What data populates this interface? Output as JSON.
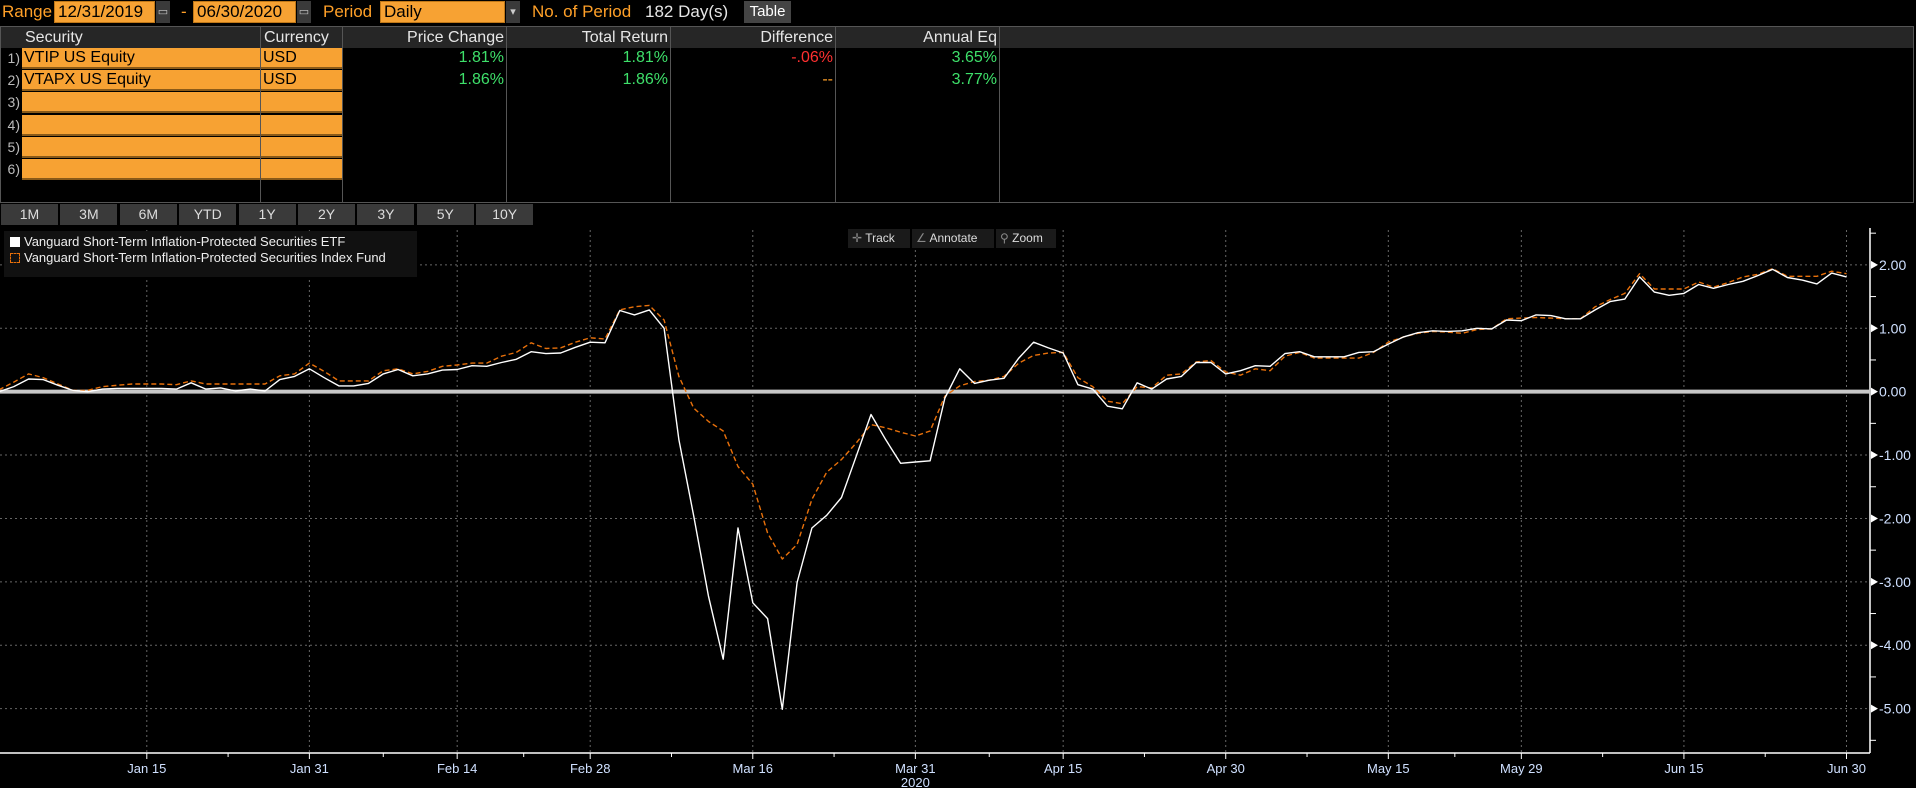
{
  "topbar": {
    "range_label": "Range",
    "start_date": "12/31/2019",
    "dash": "-",
    "end_date": "06/30/2020",
    "period_label": "Period",
    "period_value": "Daily",
    "num_period_label": "No. of Period",
    "num_period_value": "182 Day(s)",
    "table_button": "Table"
  },
  "table": {
    "headers": [
      "Security",
      "Currency",
      "Price Change",
      "Total Return",
      "Difference",
      "Annual Eq"
    ],
    "rows": [
      {
        "num": "1)",
        "security": "VTIP US Equity",
        "currency": "USD",
        "price_change": "1.81%",
        "total_return": "1.81%",
        "difference": "-.06%",
        "annual_eq": "3.65%"
      },
      {
        "num": "2)",
        "security": "VTAPX US Equity",
        "currency": "USD",
        "price_change": "1.86%",
        "total_return": "1.86%",
        "difference": "--",
        "annual_eq": "3.77%"
      },
      {
        "num": "3)",
        "security": "",
        "currency": ""
      },
      {
        "num": "4)",
        "security": "",
        "currency": ""
      },
      {
        "num": "5)",
        "security": "",
        "currency": ""
      },
      {
        "num": "6)",
        "security": "",
        "currency": ""
      }
    ]
  },
  "range_buttons": [
    "1M",
    "3M",
    "6M",
    "YTD",
    "1Y",
    "2Y",
    "3Y",
    "5Y",
    "10Y"
  ],
  "chart_tools": {
    "track": "Track",
    "annotate": "Annotate",
    "zoom": "Zoom"
  },
  "colors": {
    "accent_orange": "#f7a233",
    "positive": "#3ee06a",
    "negative": "#ff3030",
    "series_etf": "#ffffff",
    "series_fund": "#e8700a"
  },
  "chart_data": {
    "type": "line",
    "title": "",
    "xlabel": "2020",
    "ylabel": "",
    "ylim": [
      -5.7,
      2.55
    ],
    "yticks": [
      2,
      1,
      0,
      -1,
      -2,
      -3,
      -4,
      -5
    ],
    "grid": true,
    "legend_position": "top-left",
    "y_axis_side": "right",
    "xtick_dates": [
      "2020-01-15",
      "2020-01-31",
      "2020-02-14",
      "2020-02-28",
      "2020-03-16",
      "2020-03-31",
      "2020-04-15",
      "2020-04-30",
      "2020-05-15",
      "2020-05-29",
      "2020-06-15",
      "2020-06-30"
    ],
    "xtick_labels": [
      "Jan 15",
      "Jan 31",
      "Feb 14",
      "Feb 28",
      "Mar 16",
      "Mar 31",
      "Apr 15",
      "Apr 30",
      "May 15",
      "May 29",
      "Jun 15",
      "Jun 30"
    ],
    "x": [
      "2019-12-31",
      "2020-01-02",
      "2020-01-03",
      "2020-01-06",
      "2020-01-07",
      "2020-01-08",
      "2020-01-09",
      "2020-01-10",
      "2020-01-13",
      "2020-01-14",
      "2020-01-15",
      "2020-01-16",
      "2020-01-17",
      "2020-01-21",
      "2020-01-22",
      "2020-01-23",
      "2020-01-24",
      "2020-01-27",
      "2020-01-28",
      "2020-01-29",
      "2020-01-30",
      "2020-01-31",
      "2020-02-03",
      "2020-02-04",
      "2020-02-05",
      "2020-02-06",
      "2020-02-07",
      "2020-02-10",
      "2020-02-11",
      "2020-02-12",
      "2020-02-13",
      "2020-02-14",
      "2020-02-18",
      "2020-02-19",
      "2020-02-20",
      "2020-02-21",
      "2020-02-24",
      "2020-02-25",
      "2020-02-26",
      "2020-02-27",
      "2020-02-28",
      "2020-03-02",
      "2020-03-03",
      "2020-03-04",
      "2020-03-05",
      "2020-03-06",
      "2020-03-09",
      "2020-03-10",
      "2020-03-11",
      "2020-03-12",
      "2020-03-13",
      "2020-03-16",
      "2020-03-17",
      "2020-03-18",
      "2020-03-19",
      "2020-03-20",
      "2020-03-23",
      "2020-03-24",
      "2020-03-25",
      "2020-03-26",
      "2020-03-27",
      "2020-03-30",
      "2020-03-31",
      "2020-04-01",
      "2020-04-02",
      "2020-04-03",
      "2020-04-06",
      "2020-04-07",
      "2020-04-08",
      "2020-04-09",
      "2020-04-13",
      "2020-04-14",
      "2020-04-15",
      "2020-04-16",
      "2020-04-17",
      "2020-04-20",
      "2020-04-21",
      "2020-04-22",
      "2020-04-23",
      "2020-04-24",
      "2020-04-27",
      "2020-04-28",
      "2020-04-29",
      "2020-04-30",
      "2020-05-01",
      "2020-05-04",
      "2020-05-05",
      "2020-05-06",
      "2020-05-07",
      "2020-05-08",
      "2020-05-11",
      "2020-05-12",
      "2020-05-13",
      "2020-05-14",
      "2020-05-15",
      "2020-05-18",
      "2020-05-19",
      "2020-05-20",
      "2020-05-21",
      "2020-05-22",
      "2020-05-26",
      "2020-05-27",
      "2020-05-28",
      "2020-05-29",
      "2020-06-01",
      "2020-06-02",
      "2020-06-03",
      "2020-06-04",
      "2020-06-05",
      "2020-06-08",
      "2020-06-09",
      "2020-06-10",
      "2020-06-11",
      "2020-06-12",
      "2020-06-15",
      "2020-06-16",
      "2020-06-17",
      "2020-06-18",
      "2020-06-19",
      "2020-06-22",
      "2020-06-23",
      "2020-06-24",
      "2020-06-25",
      "2020-06-26",
      "2020-06-29",
      "2020-06-30"
    ],
    "series": [
      {
        "name": "Vanguard Short-Term Inflation-Protected Securities ETF",
        "style": "solid",
        "color": "#ffffff",
        "values": [
          0,
          0.08,
          0.2,
          0.19,
          0.1,
          0.02,
          0,
          0.04,
          0.05,
          0.05,
          0.05,
          0.05,
          0.04,
          0.14,
          0.04,
          0.06,
          0.01,
          0.04,
          0.01,
          0.19,
          0.24,
          0.36,
          0.22,
          0.09,
          0.09,
          0.13,
          0.28,
          0.35,
          0.25,
          0.28,
          0.34,
          0.35,
          0.41,
          0.4,
          0.46,
          0.51,
          0.63,
          0.6,
          0.61,
          0.7,
          0.78,
          0.77,
          1.28,
          1.21,
          1.29,
          1.0,
          -0.76,
          -1.96,
          -3.22,
          -4.22,
          -2.15,
          -3.33,
          -3.58,
          -5.01,
          -3.01,
          -2.15,
          -1.95,
          -1.67,
          -1.02,
          -0.36,
          -0.76,
          -1.13,
          -1.11,
          -1.09,
          -0.1,
          0.36,
          0.13,
          0.18,
          0.21,
          0.53,
          0.78,
          0.69,
          0.61,
          0.11,
          0.04,
          -0.23,
          -0.27,
          0.14,
          0.04,
          0.2,
          0.24,
          0.46,
          0.46,
          0.28,
          0.33,
          0.41,
          0.4,
          0.6,
          0.63,
          0.55,
          0.55,
          0.55,
          0.62,
          0.63,
          0.75,
          0.86,
          0.93,
          0.96,
          0.95,
          0.96,
          1.0,
          0.99,
          1.13,
          1.12,
          1.21,
          1.2,
          1.15,
          1.15,
          1.29,
          1.42,
          1.46,
          1.81,
          1.57,
          1.52,
          1.55,
          1.69,
          1.63,
          1.69,
          1.74,
          1.83,
          1.93,
          1.8,
          1.76,
          1.7,
          1.87,
          1.81
        ]
      },
      {
        "name": "Vanguard Short-Term Inflation-Protected Securities Index Fund",
        "style": "dashed",
        "color": "#e8700a",
        "values": [
          0.03,
          0.15,
          0.28,
          0.22,
          0.12,
          0.02,
          0.02,
          0.08,
          0.1,
          0.12,
          0.12,
          0.12,
          0.11,
          0.17,
          0.12,
          0.12,
          0.12,
          0.12,
          0.12,
          0.25,
          0.28,
          0.45,
          0.32,
          0.17,
          0.17,
          0.17,
          0.33,
          0.36,
          0.28,
          0.32,
          0.4,
          0.42,
          0.45,
          0.45,
          0.56,
          0.62,
          0.77,
          0.68,
          0.69,
          0.78,
          0.85,
          0.83,
          1.29,
          1.34,
          1.36,
          1.13,
          0.24,
          -0.26,
          -0.47,
          -0.62,
          -1.18,
          -1.46,
          -2.23,
          -2.64,
          -2.41,
          -1.7,
          -1.27,
          -1.07,
          -0.81,
          -0.52,
          -0.57,
          -0.64,
          -0.7,
          -0.62,
          -0.07,
          0.09,
          0.16,
          0.18,
          0.24,
          0.45,
          0.57,
          0.61,
          0.62,
          0.22,
          0.08,
          -0.15,
          -0.19,
          0.08,
          0.06,
          0.26,
          0.28,
          0.47,
          0.49,
          0.31,
          0.26,
          0.36,
          0.33,
          0.56,
          0.62,
          0.53,
          0.53,
          0.53,
          0.53,
          0.62,
          0.78,
          0.86,
          0.92,
          0.95,
          0.94,
          0.92,
          0.98,
          0.99,
          1.15,
          1.16,
          1.17,
          1.16,
          1.15,
          1.15,
          1.34,
          1.45,
          1.55,
          1.86,
          1.62,
          1.62,
          1.62,
          1.73,
          1.65,
          1.72,
          1.81,
          1.85,
          1.94,
          1.82,
          1.82,
          1.82,
          1.9,
          1.86
        ]
      }
    ]
  }
}
